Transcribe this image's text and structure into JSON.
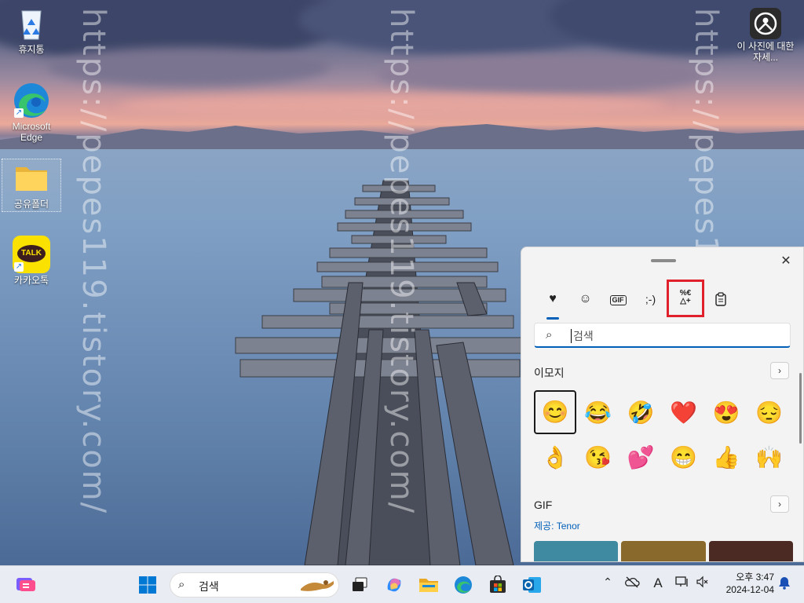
{
  "watermark": {
    "text": "https://pepes119.tistory.com/"
  },
  "desktop_icons": [
    {
      "label": "휴지통",
      "icon": "recycle-bin-icon"
    },
    {
      "label": "Microsoft Edge",
      "icon": "edge-icon"
    },
    {
      "label": "공유폴더",
      "icon": "folder-icon"
    },
    {
      "label": "카카오톡",
      "icon": "kakaotalk-icon"
    },
    {
      "label": "이 사진에 대한 자세...",
      "icon": "learn-about-picture-icon"
    }
  ],
  "kakaotalk_logo_text": "TALK",
  "emoji_panel": {
    "tabs": [
      {
        "name": "recent",
        "icon": "heart-clock-icon"
      },
      {
        "name": "emoji",
        "icon": "smiley-icon"
      },
      {
        "name": "gif",
        "label": "GIF"
      },
      {
        "name": "kaomoji",
        "label": ";-)"
      },
      {
        "name": "symbols",
        "label": "%€ △+"
      },
      {
        "name": "clipboard",
        "icon": "clipboard-icon"
      }
    ],
    "search_placeholder": "검색",
    "emoji_section_title": "이모지",
    "emojis": [
      "😊",
      "😂",
      "🤣",
      "❤️",
      "😍",
      "😔",
      "👌",
      "😘",
      "💕",
      "😁",
      "👍",
      "🙌"
    ],
    "gif_section_title": "GIF",
    "gif_provider": "제공: Tenor",
    "more_chevron": "›",
    "close_glyph": "✕",
    "highlight_color": "#e0202a",
    "accent_color": "#005fb8"
  },
  "taskbar": {
    "search_text": "검색",
    "clock_time": "오후 3:47",
    "clock_date": "2024-12-04",
    "ime_letter": "A"
  }
}
